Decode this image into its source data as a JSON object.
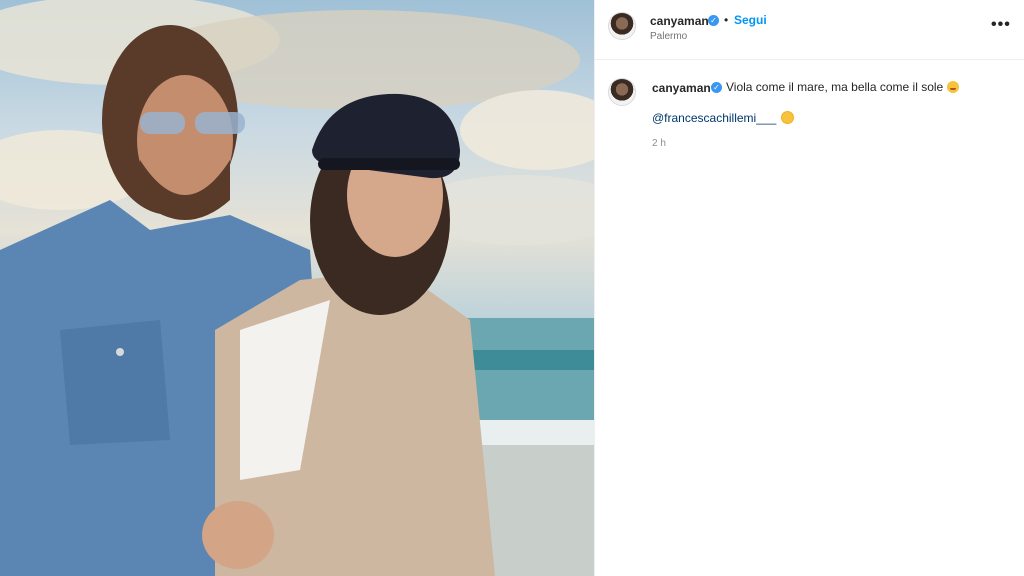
{
  "post": {
    "username": "canyaman",
    "verified_badge": "✓",
    "separator": "•",
    "follow_label": "Segui",
    "location": "Palermo",
    "more_label": "•••"
  },
  "comment": {
    "username": "canyaman",
    "caption": "Viola come il mare, ma bella come il sole",
    "mention": "@francescachillemi___",
    "timestamp": "2 h"
  },
  "icons": {
    "verified": "verified-badge-icon",
    "more": "more-options-icon",
    "caption_emoji": "hugging-face-emoji",
    "mention_emoji": "sun-emoji"
  },
  "colors": {
    "accent_blue": "#0095f6",
    "verified_blue": "#3897f0",
    "mention_blue": "#00376b",
    "text": "#262626",
    "muted": "#8e8e8e"
  }
}
